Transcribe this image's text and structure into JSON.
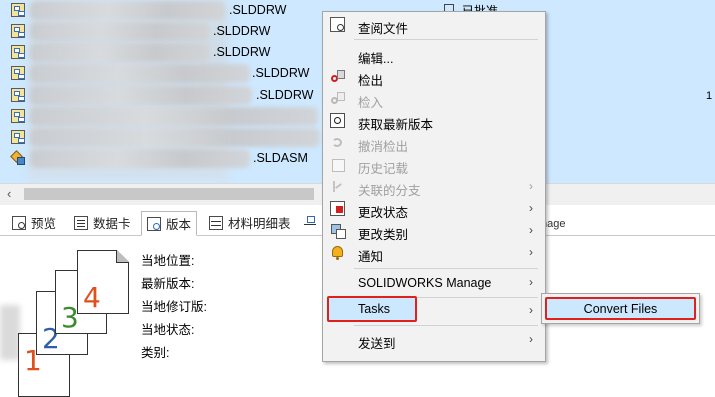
{
  "file_list": {
    "rows": [
      {
        "ext": ".SLDDRW",
        "icon": "drawing-icon",
        "state": "已批准"
      },
      {
        "ext": ".SLDDRW",
        "icon": "drawing-icon",
        "state": ""
      },
      {
        "ext": ".SLDDRW",
        "icon": "drawing-icon",
        "state": ""
      },
      {
        "ext": ".SLDDRW",
        "icon": "drawing-icon",
        "state": ""
      },
      {
        "ext": ".SLDDRW",
        "icon": "drawing-icon",
        "state": ""
      },
      {
        "ext": "",
        "icon": "drawing-icon",
        "state": ""
      },
      {
        "ext": "",
        "icon": "drawing-icon",
        "state": ""
      },
      {
        "ext": ".SLDASM",
        "icon": "assembly-icon",
        "state": ""
      }
    ],
    "edge_digit": "1"
  },
  "tabs": [
    {
      "label": "预览",
      "icon": "preview-icon"
    },
    {
      "label": "数据卡",
      "icon": "datacard-icon"
    },
    {
      "label": "版本",
      "icon": "version-icon",
      "active": true
    },
    {
      "label": "材料明细表",
      "icon": "bom-icon"
    },
    {
      "label": "",
      "icon": "where-used-icon"
    }
  ],
  "tab_partial": "nage",
  "details": {
    "labels": [
      "当地位置:",
      "最新版本:",
      "当地修订版:",
      "当地状态:",
      "类别:"
    ]
  },
  "doc_stack": {
    "numbers": [
      "1",
      "2",
      "3",
      "4"
    ]
  },
  "context_menu": {
    "items": [
      {
        "label": "查阅文件",
        "icon": "view-file-icon",
        "disabled": false,
        "submenu": false
      },
      {
        "label": "编辑...",
        "icon": "",
        "disabled": false,
        "submenu": false
      },
      {
        "label": "检出",
        "icon": "check-out-icon",
        "disabled": false,
        "submenu": false
      },
      {
        "label": "检入",
        "icon": "check-in-icon",
        "disabled": true,
        "submenu": false
      },
      {
        "label": "获取最新版本",
        "icon": "get-latest-icon",
        "disabled": false,
        "submenu": false
      },
      {
        "label": "撤消检出",
        "icon": "undo-checkout-icon",
        "disabled": true,
        "submenu": false
      },
      {
        "label": "历史记载",
        "icon": "history-icon",
        "disabled": true,
        "submenu": false
      },
      {
        "label": "关联的分支",
        "icon": "branch-icon",
        "disabled": true,
        "submenu": true
      },
      {
        "label": "更改状态",
        "icon": "change-state-icon",
        "disabled": false,
        "submenu": true
      },
      {
        "label": "更改类别",
        "icon": "change-category-icon",
        "disabled": false,
        "submenu": true
      },
      {
        "label": "通知",
        "icon": "notify-icon",
        "disabled": false,
        "submenu": true
      },
      {
        "label": "SOLIDWORKS Manage",
        "icon": "",
        "disabled": false,
        "submenu": true
      },
      {
        "label": "Tasks",
        "icon": "",
        "disabled": false,
        "submenu": true,
        "highlighted": true
      },
      {
        "label": "发送到",
        "icon": "",
        "disabled": false,
        "submenu": true
      }
    ]
  },
  "submenu": {
    "items": [
      {
        "label": "Convert Files",
        "highlighted": true
      }
    ]
  },
  "colors": {
    "selection": "#cde8ff",
    "menu_bg": "#f2f2f2",
    "highlight_border": "#e0201b",
    "disabled_text": "#a0a0a0",
    "doc_num_1": "#e0501a",
    "doc_num_2": "#2f5fa8",
    "doc_num_3": "#3c8a2e",
    "doc_num_4": "#e0501a"
  }
}
